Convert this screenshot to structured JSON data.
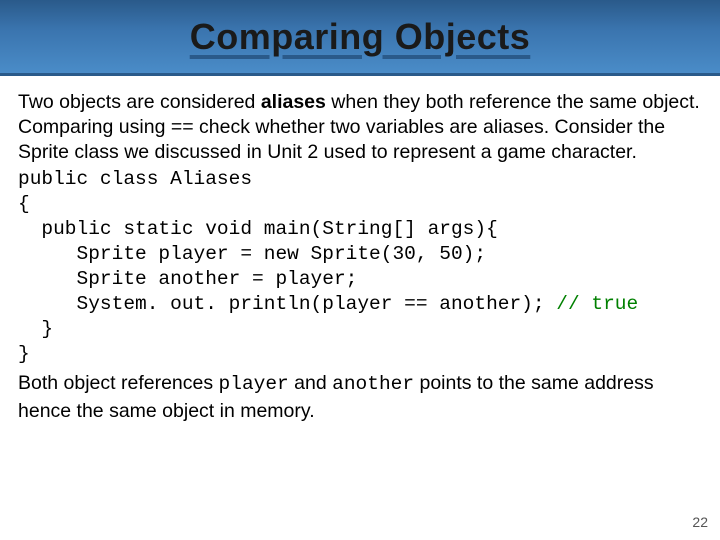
{
  "title": "Comparing Objects",
  "para1_a": "Two objects are considered ",
  "para1_bold": "aliases",
  "para1_b": " when they both reference the same object. Comparing using == check whether two variables are aliases. Consider the Sprite class we discussed in Unit 2 used to represent a game character.",
  "code": {
    "l1": "public class Aliases",
    "l2": "{",
    "l3": "  public static void main(String[] args){",
    "l4": "     Sprite player = new Sprite(30, 50);",
    "l5": "     Sprite another = player;",
    "l6a": "     System. out. println(player == another); ",
    "l6b": "// true",
    "l7": "  }",
    "l8": "}"
  },
  "para2_a": "Both object references ",
  "para2_m1": "player",
  "para2_b": " and ",
  "para2_m2": "another",
  "para2_c": " points to the same address hence the same object in memory.",
  "page": "22"
}
